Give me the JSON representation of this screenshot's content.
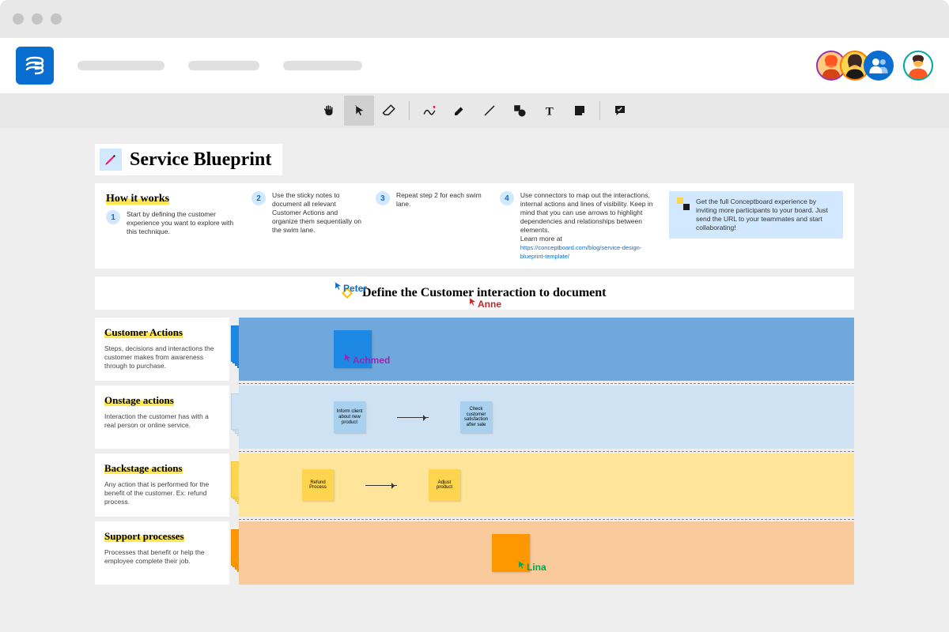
{
  "title": "Service Blueprint",
  "how_it_works": {
    "title": "How it works",
    "steps": [
      {
        "num": "1",
        "text": "Start by defining the customer experience you want to explore with this technique."
      },
      {
        "num": "2",
        "text": "Use the sticky notes to document all relevant Customer Actions and organize them sequentially on the swim lane."
      },
      {
        "num": "3",
        "text": "Repeat step 2 for each swim lane."
      },
      {
        "num": "4",
        "text": "Use connectors to map out the interactions, internal actions and lines of visibility. Keep in mind that you can use arrows to highlight dependencies and relationships between elements.",
        "link_prefix": "Learn more at ",
        "link": "https://conceptboard.com/blog/service-design-blueprint-template/"
      }
    ],
    "promo": "Get the full Conceptboard experience by inviting more participants to your board. Just send the URL to your teammates and start collaborating!"
  },
  "section_prompt": "Define the Customer interaction to document",
  "cursors": {
    "peter": "Peter",
    "anne": "Anne",
    "achmed": "Achmed",
    "lina": "Lina"
  },
  "lanes": [
    {
      "title": "Customer Actions",
      "desc": "Steps, decisions and interactions the customer makes from awareness through to purchase."
    },
    {
      "title": "Onstage actions",
      "desc": "Interaction the customer has with a real person or online service."
    },
    {
      "title": "Backstage actions",
      "desc": "Any action that is performed for the benefit of the customer. Ex: refund process."
    },
    {
      "title": "Support processes",
      "desc": "Processes that benefit or help the employee complete their job."
    }
  ],
  "stickies": {
    "onstage": [
      "Inform client about new product",
      "Check customer satisfaction after sale"
    ],
    "backstage": [
      "Refund Process",
      "Adjust product"
    ]
  }
}
